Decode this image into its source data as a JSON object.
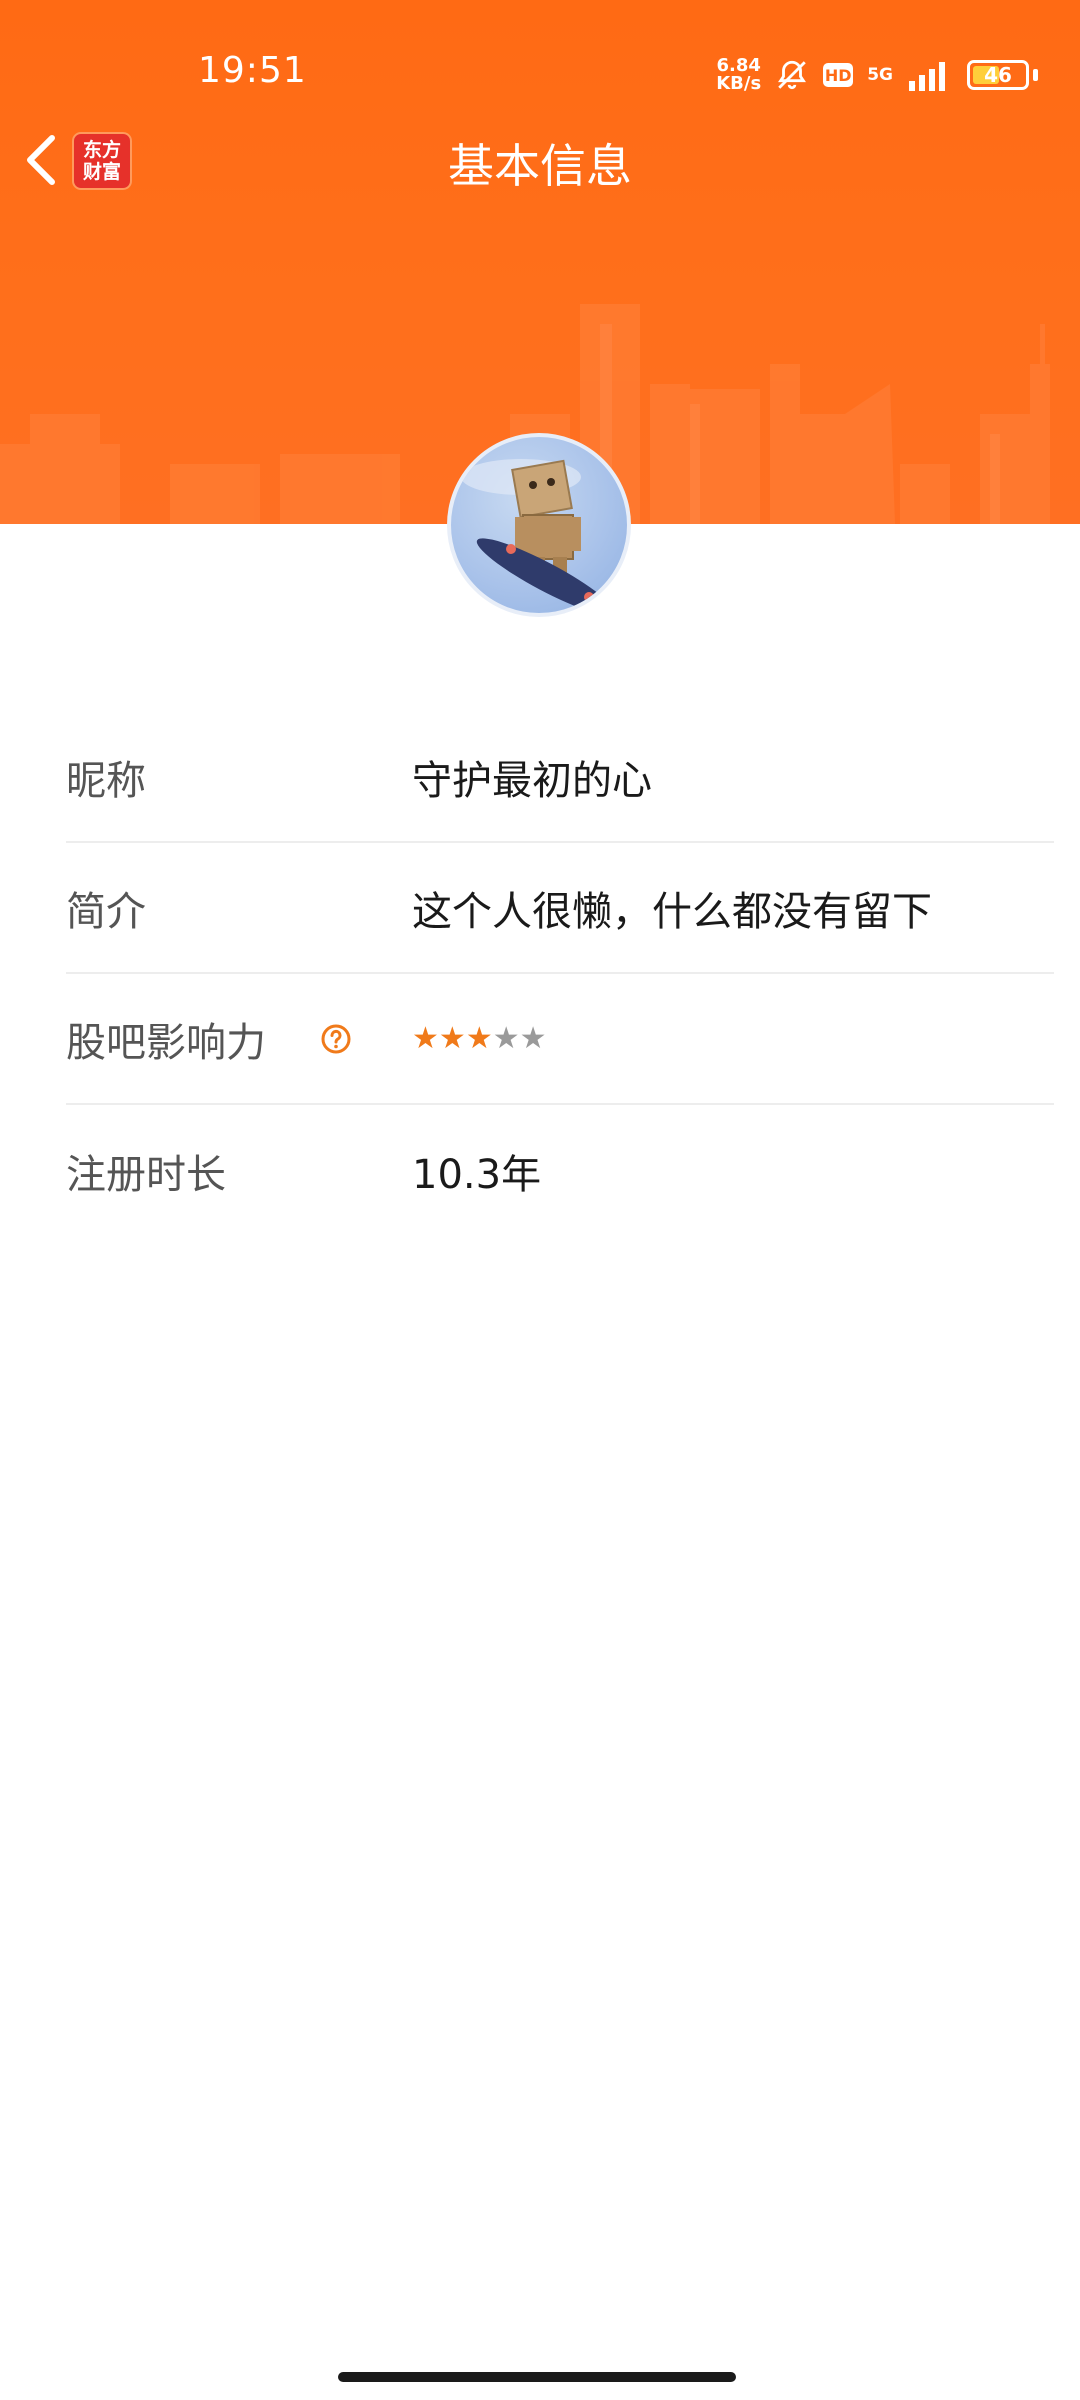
{
  "status_bar": {
    "time": "19:51",
    "net_speed_value": "6.84",
    "net_speed_unit": "KB/s",
    "hd": "HD",
    "network": "5G",
    "battery": "46"
  },
  "nav": {
    "title": "基本信息",
    "logo_line1": "东方",
    "logo_line2": "财富"
  },
  "profile": {
    "rows": [
      {
        "label": "昵称",
        "value": "守护最初的心"
      },
      {
        "label": "简介",
        "value": "这个人很懒，什么都没有留下"
      },
      {
        "label": "股吧影响力",
        "rating": 3,
        "rating_max": 5,
        "help_icon": "question-circle-icon"
      },
      {
        "label": "注册时长",
        "value": "10.3年"
      }
    ]
  },
  "colors": {
    "header": "#ff6a14",
    "star_on": "#f07a1a",
    "star_off": "#9a9a9a"
  }
}
